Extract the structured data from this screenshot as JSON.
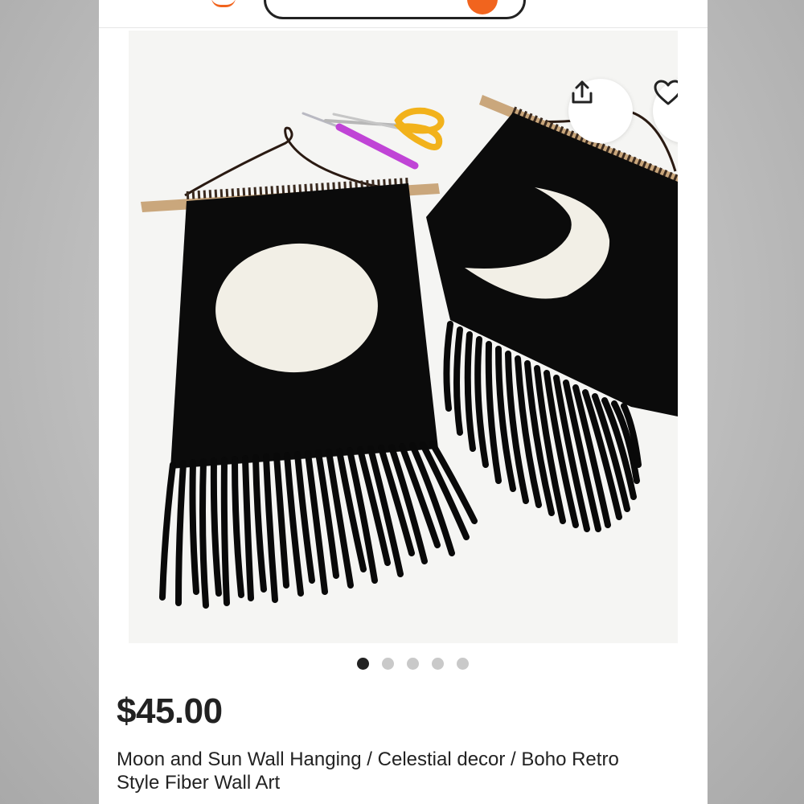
{
  "listing": {
    "price": "$45.00",
    "title": "Moon and Sun Wall Hanging / Celestial decor / Boho Retro Style Fiber Wall Art"
  },
  "actions": {
    "share_icon": "share-upload-icon",
    "favorite_icon": "heart-outline-icon"
  },
  "gallery": {
    "image_count": 5,
    "active_index": 0
  },
  "colors": {
    "brand_accent": "#f1641e",
    "text": "#222222",
    "dot_inactive": "#c9c9c9"
  }
}
